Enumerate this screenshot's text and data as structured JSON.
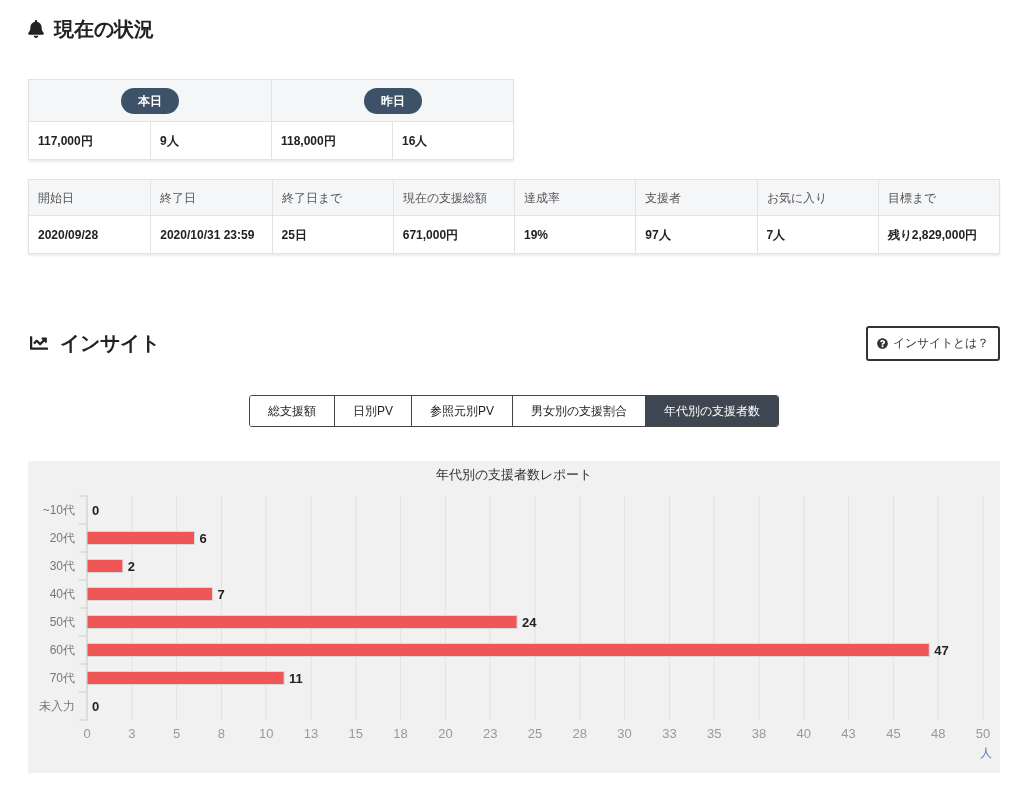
{
  "status_section": {
    "title": "現在の状況"
  },
  "summary": {
    "periods": [
      {
        "label": "本日",
        "amount": "117,000円",
        "supporters": "9人"
      },
      {
        "label": "昨日",
        "amount": "118,000円",
        "supporters": "16人"
      }
    ]
  },
  "stats": {
    "columns": [
      "開始日",
      "終了日",
      "終了日まで",
      "現在の支援総額",
      "達成率",
      "支援者",
      "お気に入り",
      "目標まで"
    ],
    "row": [
      "2020/09/28",
      "2020/10/31 23:59",
      "25日",
      "671,000円",
      "19%",
      "97人",
      "7人",
      "残り2,829,000円"
    ]
  },
  "insight": {
    "title": "インサイト",
    "help_button": "インサイトとは？",
    "tabs": [
      {
        "label": "総支援額",
        "selected": false
      },
      {
        "label": "日別PV",
        "selected": false
      },
      {
        "label": "参照元別PV",
        "selected": false
      },
      {
        "label": "男女別の支援割合",
        "selected": false
      },
      {
        "label": "年代別の支援者数",
        "selected": true
      }
    ],
    "chart_data": {
      "type": "bar",
      "orientation": "horizontal",
      "title": "年代別の支援者数レポート",
      "xlabel": "人",
      "categories": [
        "~10代",
        "20代",
        "30代",
        "40代",
        "50代",
        "60代",
        "70代",
        "未入力"
      ],
      "values": [
        0,
        6,
        2,
        7,
        24,
        47,
        11,
        0
      ],
      "xlim": [
        0,
        50
      ],
      "xticks": [
        0,
        {
          "value": 2.5,
          "label": "3"
        },
        5,
        {
          "value": 7.5,
          "label": "8"
        },
        10,
        {
          "value": 12.5,
          "label": "13"
        },
        15,
        {
          "value": 17.5,
          "label": "18"
        },
        20,
        {
          "value": 22.5,
          "label": "23"
        },
        25,
        {
          "value": 27.5,
          "label": "28"
        },
        30,
        {
          "value": 32.5,
          "label": "33"
        },
        35,
        {
          "value": 37.5,
          "label": "38"
        },
        40,
        {
          "value": 42.5,
          "label": "43"
        },
        45,
        {
          "value": 47.5,
          "label": "48"
        },
        50
      ],
      "data_labels": true,
      "grid": true
    }
  }
}
